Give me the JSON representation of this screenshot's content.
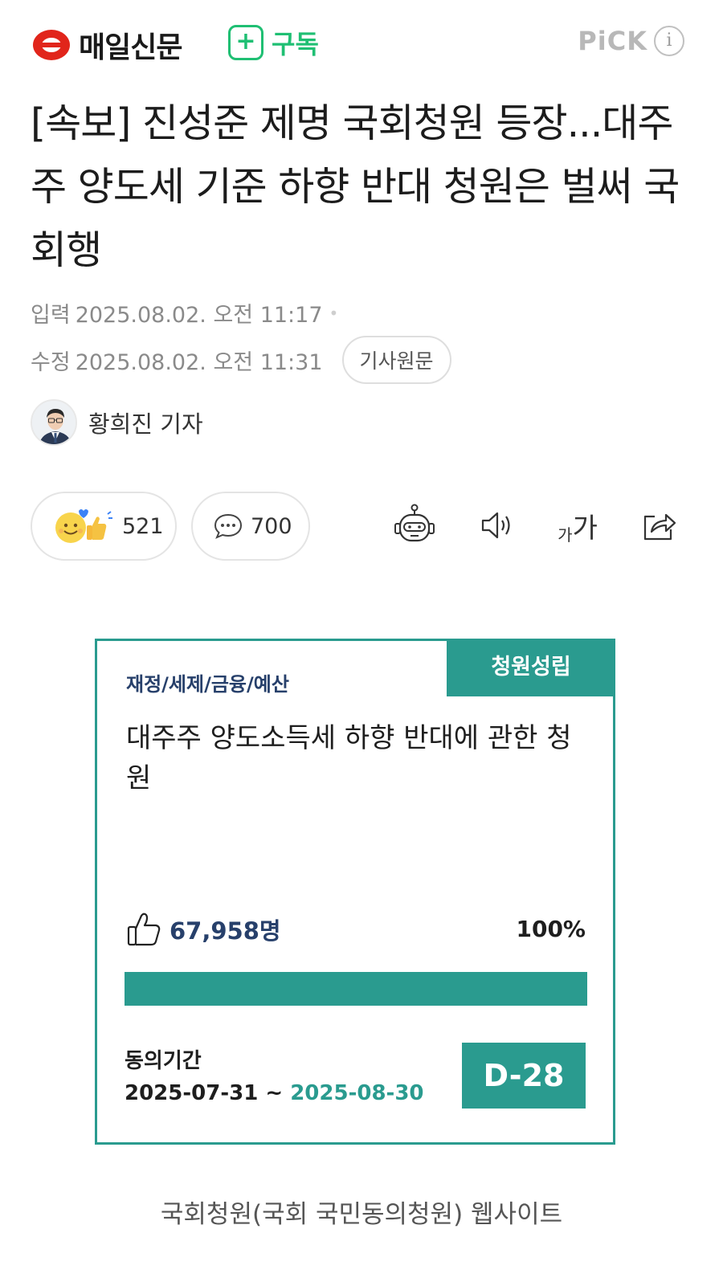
{
  "header": {
    "publisher": "매일신문",
    "subscribe_plus": "+",
    "subscribe_label": "구독",
    "pick_label": "PiCK",
    "info_glyph": "i"
  },
  "article": {
    "headline": "[속보] 진성준 제명 국회청원 등장...대주주 양도세 기준 하향 반대 청원은 벌써 국회행",
    "published_label": "입력",
    "published_value": "2025.08.02. 오전 11:17",
    "modified_label": "수정",
    "modified_value": "2025.08.02. 오전 11:31",
    "original_button": "기사원문",
    "author": "황희진 기자"
  },
  "reactions": {
    "like_count": "521",
    "comment_count": "700",
    "font_size_label_small": "가",
    "font_size_label_large": "가"
  },
  "petition": {
    "badge": "청원성립",
    "category": "재정/세제/금융/예산",
    "title": "대주주 양도소득세 하향 반대에 관한 청원",
    "supporters": "67,958명",
    "percent_label": "100%",
    "progress": 1.0,
    "period_label": "동의기간",
    "period_start": "2025-07-31 ~ ",
    "period_end": "2025-08-30",
    "dday": "D-28"
  },
  "caption": "국회청원(국회 국민동의청원) 웹사이트",
  "colors": {
    "brand_red": "#e1251b",
    "subscribe_green": "#1fbf73",
    "petition_teal": "#2a9b8f",
    "petition_navy": "#27406b"
  },
  "icons": [
    "logo-mark-icon",
    "plus-icon",
    "info-icon",
    "smile-reaction-icon",
    "thumbs-up-icon",
    "comment-bubble-icon",
    "ai-robot-icon",
    "speaker-icon",
    "font-size-icon",
    "share-icon",
    "like-outline-icon"
  ]
}
